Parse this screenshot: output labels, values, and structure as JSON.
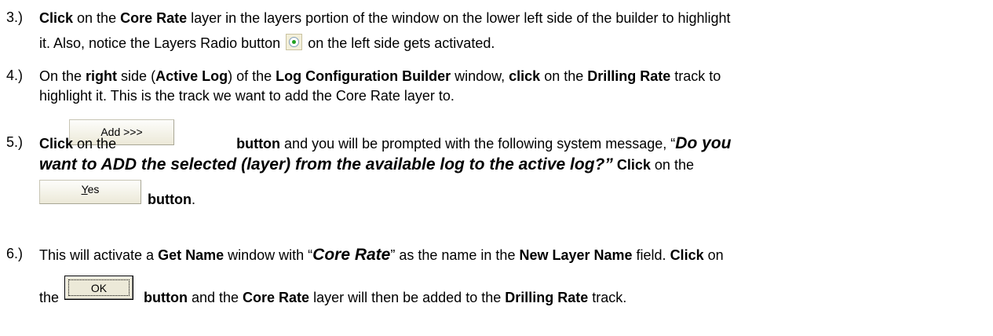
{
  "steps": [
    {
      "number": "3.)",
      "line1": {
        "t1": "Click",
        "t2": " on the ",
        "t3": "Core Rate",
        "t4": " layer in the layers portion of the window on the lower left side of the builder to highlight"
      },
      "line2": {
        "t1": "it. Also, notice the Layers Radio button ",
        "t2": " on the left side gets activated."
      },
      "radio_icon": "radio-button-selected-icon"
    },
    {
      "number": "4.)",
      "line1": {
        "t1": "On the ",
        "t2": "right",
        "t3": " side (",
        "t4": "Active Log",
        "t5": ") of the ",
        "t6": "Log Configuration Builder",
        "t7": " window, ",
        "t8": "click",
        "t9": " on the ",
        "t10": "Drilling Rate",
        "t11": " track to"
      },
      "line2": "highlight it. This is the track we want to add the Core Rate layer to."
    },
    {
      "number": "5.)",
      "add_button_label": "Add >>>",
      "line1": {
        "t1": "Click",
        "t2": " on the ",
        "t3": "button",
        "t4": " and you will be prompted with the following system message, “",
        "t5": "Do you"
      },
      "line2": {
        "t1": "want to ADD the selected (layer) from the available log to the active log?”",
        "t2": " ",
        "t3": "Click",
        "t4": " on the"
      },
      "yes_button": {
        "underlined": "Y",
        "rest": "es"
      },
      "line3": {
        "t1": "button",
        "t2": "."
      }
    },
    {
      "number": "6.)",
      "line1": {
        "t1": "This will activate a ",
        "t2": "Get Name",
        "t3": " window with “",
        "t4": "Core Rate",
        "t5": "” as the name in the ",
        "t6": "New Layer Name",
        "t7": " field. ",
        "t8": "Click",
        "t9": " on"
      },
      "ok_button_label": "OK",
      "line2": {
        "t0": "the",
        "t1": "button",
        "t2": " and the ",
        "t3": "Core Rate",
        "t4": " layer will then be added to the ",
        "t5": "Drilling Rate",
        "t6": " track."
      }
    }
  ]
}
